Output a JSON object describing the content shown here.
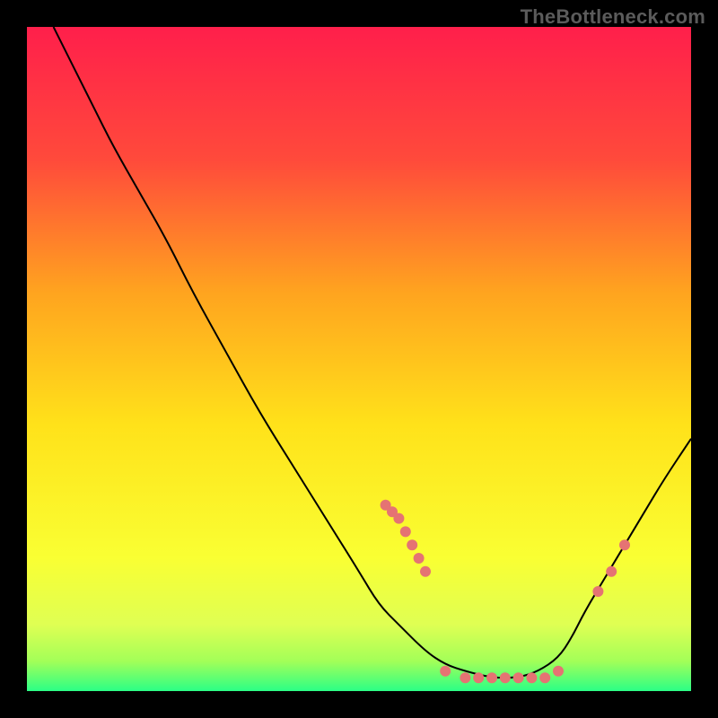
{
  "watermark": "TheBottleneck.com",
  "chart_data": {
    "type": "line",
    "title": "",
    "xlabel": "",
    "ylabel": "",
    "xlim": [
      0,
      100
    ],
    "ylim": [
      0,
      100
    ],
    "grid": false,
    "legend": false,
    "gradient_stops": [
      {
        "offset": 0.0,
        "color": "#ff1f4b"
      },
      {
        "offset": 0.2,
        "color": "#ff4a3b"
      },
      {
        "offset": 0.4,
        "color": "#ffa41f"
      },
      {
        "offset": 0.6,
        "color": "#ffe21a"
      },
      {
        "offset": 0.8,
        "color": "#f9ff33"
      },
      {
        "offset": 0.9,
        "color": "#dfff53"
      },
      {
        "offset": 0.955,
        "color": "#a3ff58"
      },
      {
        "offset": 1.0,
        "color": "#2bff86"
      }
    ],
    "series": [
      {
        "name": "bottleneck_curve",
        "color": "#000000",
        "x": [
          4,
          6,
          8,
          10,
          13,
          17,
          21,
          25,
          30,
          35,
          40,
          45,
          50,
          53,
          56,
          60,
          63,
          66,
          70,
          74,
          77,
          80,
          82,
          84,
          87,
          90,
          93,
          96,
          100
        ],
        "y": [
          100,
          96,
          92,
          88,
          82,
          75,
          68,
          60,
          51,
          42,
          34,
          26,
          18,
          13,
          10,
          6,
          4,
          3,
          2,
          2,
          3,
          5,
          8,
          12,
          17,
          22,
          27,
          32,
          38
        ]
      }
    ],
    "scatter_points": {
      "name": "highlight_points",
      "color": "#e57373",
      "radius": 6,
      "x": [
        54,
        55,
        56,
        57,
        58,
        59,
        60,
        63,
        66,
        68,
        70,
        72,
        74,
        76,
        78,
        80,
        86,
        88,
        90
      ],
      "y": [
        28,
        27,
        26,
        24,
        22,
        20,
        18,
        3,
        2,
        2,
        2,
        2,
        2,
        2,
        2,
        3,
        15,
        18,
        22
      ]
    }
  }
}
